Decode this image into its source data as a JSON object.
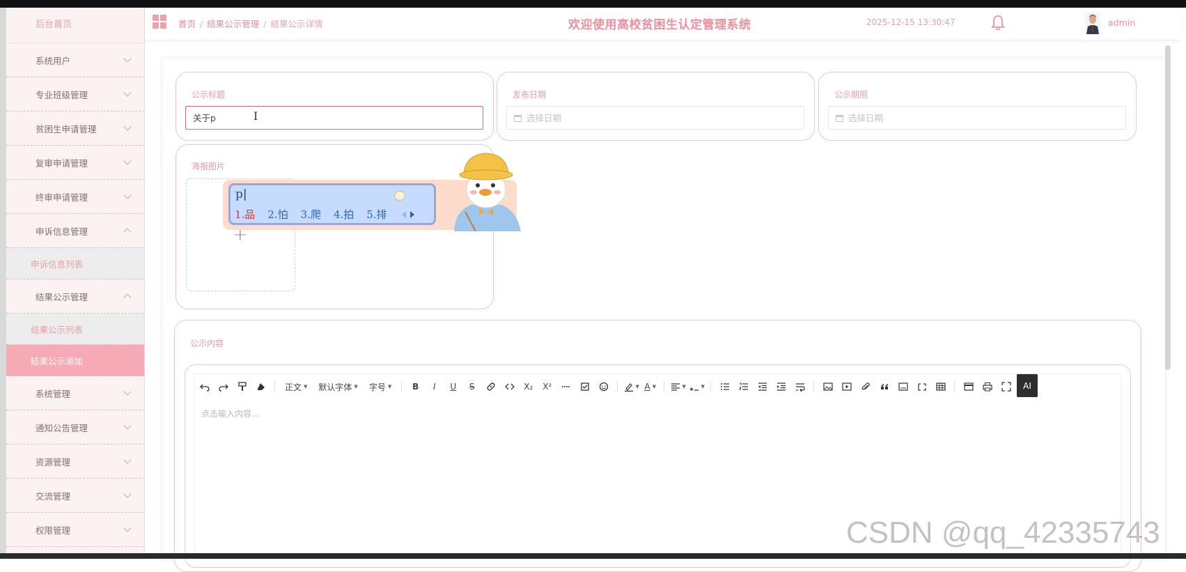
{
  "app": {
    "site_title": "欢迎使用高校贫困生认定管理系统",
    "datetime": "2025-12-15 13:30:47",
    "user": "admin"
  },
  "breadcrumb": {
    "home": "首页",
    "section": "结果公示管理",
    "current": "结果公示详情",
    "separator": "/"
  },
  "sidebar": {
    "home": "后台首页",
    "items": [
      {
        "label": "系统用户",
        "expanded": false
      },
      {
        "label": "专业班级管理",
        "expanded": false
      },
      {
        "label": "贫困生申请管理",
        "expanded": false
      },
      {
        "label": "复审申请管理",
        "expanded": false
      },
      {
        "label": "终审申请管理",
        "expanded": false
      },
      {
        "label": "申诉信息管理",
        "expanded": true,
        "children": [
          {
            "label": "申诉信息列表"
          }
        ]
      },
      {
        "label": "结果公示管理",
        "expanded": true,
        "children": [
          {
            "label": "结果公示列表"
          },
          {
            "label": "结果公示添加",
            "active": true
          }
        ]
      },
      {
        "label": "系统管理",
        "expanded": false
      },
      {
        "label": "通知公告管理",
        "expanded": false
      },
      {
        "label": "资源管理",
        "expanded": false
      },
      {
        "label": "交流管理",
        "expanded": false
      },
      {
        "label": "权限管理",
        "expanded": false
      }
    ]
  },
  "form": {
    "title_label": "公示标题",
    "title_value": "关于p",
    "publish_date_label": "发布日期",
    "publish_date_placeholder": "选择日期",
    "deadline_label": "公示期限",
    "deadline_placeholder": "选择日期",
    "poster_label": "海报图片",
    "upload_plus": "+",
    "content_label": "公示内容",
    "editor_placeholder": "点击输入内容..."
  },
  "ime": {
    "composition": "p",
    "candidates": [
      "1.品",
      "2.怕",
      "3.爬",
      "4.拍",
      "5.排"
    ]
  },
  "toolbar": {
    "heading": "正文",
    "font_family": "默认字体",
    "font_size": "字号",
    "ai": "AI",
    "icons": [
      "undo-icon",
      "redo-icon",
      "format-painter-icon",
      "clear-format-icon",
      "bold-icon",
      "italic-icon",
      "underline-icon",
      "strikethrough-icon",
      "link-icon",
      "code-icon",
      "subscript-icon",
      "superscript-icon",
      "divider-icon",
      "todo-icon",
      "emoji-icon",
      "highlight-icon",
      "font-color-icon",
      "align-icon",
      "line-height-icon",
      "bulleted-list-icon",
      "numbered-list-icon",
      "indent-decrease-icon",
      "indent-increase-icon",
      "line-break-icon",
      "image-icon",
      "video-icon",
      "attachment-icon",
      "quote-icon",
      "code-block-icon",
      "container-icon",
      "table-icon",
      "template-icon",
      "print-icon",
      "fullscreen-icon"
    ],
    "bold": "B",
    "italic": "I",
    "underline": "U",
    "strike": "S",
    "subscript": "X₂",
    "superscript": "X²",
    "font_color": "A"
  },
  "watermark": "CSDN @qq_42335743",
  "colors": {
    "accent": "#f6aab6",
    "title": "#eb8f9f",
    "card_border": "#f0c5c9"
  }
}
